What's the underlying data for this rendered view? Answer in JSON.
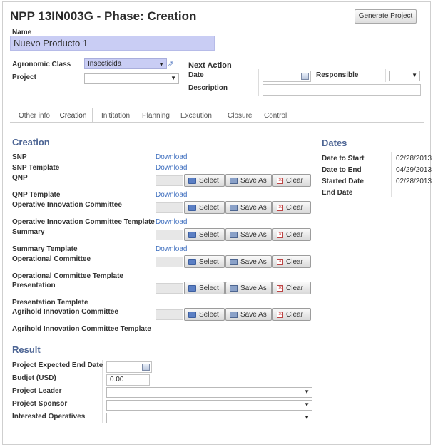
{
  "header": {
    "title": "NPP 13IN003G - Phase: Creation",
    "generate_button": "Generate Project"
  },
  "form": {
    "name_label": "Name",
    "name_value": "Nuevo Producto 1",
    "agronomic_label": "Agronomic Class",
    "agronomic_value": "Insecticida",
    "project_label": "Project",
    "project_value": "",
    "next_action_label": "Next Action",
    "date_label": "Date",
    "description_label": "Description",
    "responsible_label": "Responsible"
  },
  "tabs": [
    "Other info",
    "Creation",
    "Inititation",
    "Planning",
    "Exceution",
    "Closure",
    "Control"
  ],
  "creation": {
    "title": "Creation",
    "buttons": {
      "select": "Select",
      "save_as": "Save As",
      "clear": "Clear"
    },
    "download": "Download",
    "rows": [
      "SNP",
      "SNP Template",
      "QNP",
      "QNP Template",
      "Operative Innovation Committee",
      "Operative Innovation Committee Template",
      "Summary",
      "Summary Template",
      "Operational Committee",
      "Operational Committee Template",
      "Presentation",
      "Presentation Template",
      "Agrihold Innovation Committee",
      "Agrihold Innovation Committee Template"
    ]
  },
  "dates": {
    "title": "Dates",
    "items": [
      {
        "label": "Date to Start",
        "value": "02/28/2013"
      },
      {
        "label": "Date to End",
        "value": "04/29/2013"
      },
      {
        "label": "Started Date",
        "value": "02/28/2013"
      },
      {
        "label": "End Date",
        "value": ""
      }
    ]
  },
  "result": {
    "title": "Result",
    "expected_end_label": "Project Expected End Date",
    "budget_label": "Budjet (USD)",
    "budget_value": "0.00",
    "leader_label": "Project Leader",
    "sponsor_label": "Project Sponsor",
    "operatives_label": "Interested Operatives"
  },
  "colors": {
    "accent": "#4d6594",
    "link": "#3f6fbf",
    "highlight": "#c9cdf4"
  },
  "icons": [
    "share-icon",
    "calendar-icon",
    "folder-icon",
    "save-icon",
    "clear-icon",
    "chevron-down-icon"
  ]
}
